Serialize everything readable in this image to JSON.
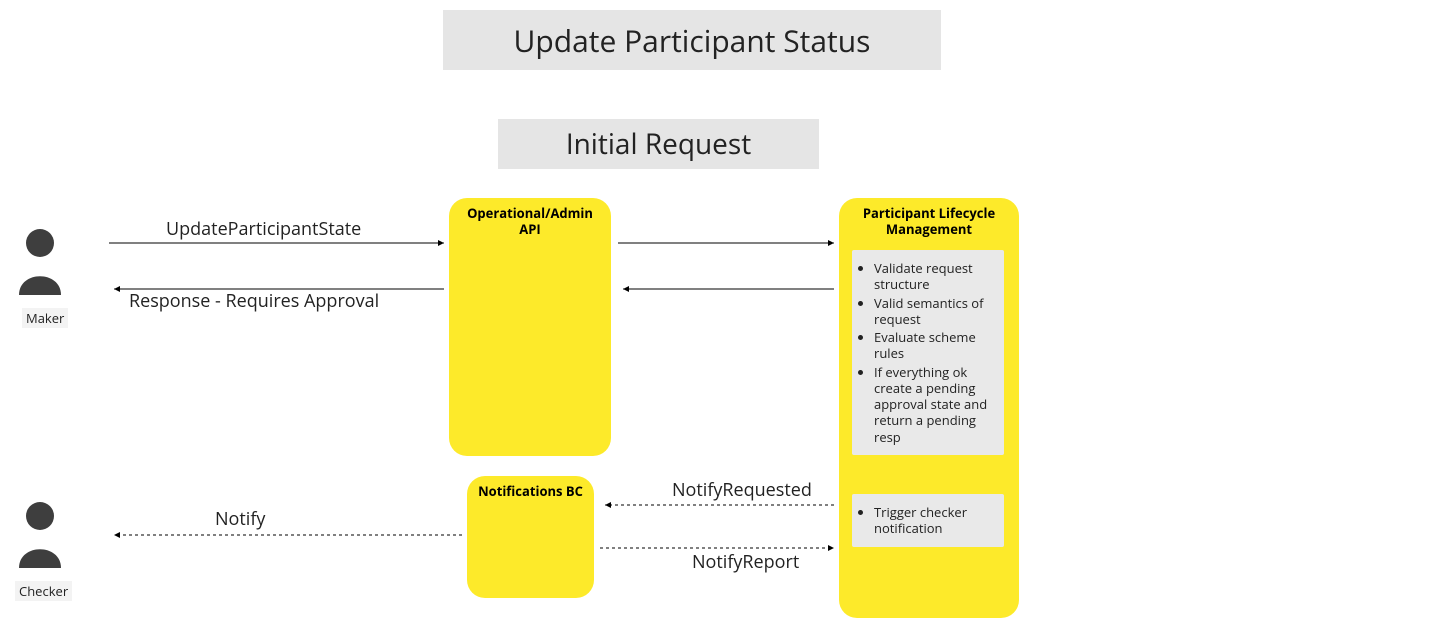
{
  "title": "Update Participant Status",
  "subtitle": "Initial Request",
  "actors": {
    "maker": "Maker",
    "checker": "Checker"
  },
  "components": {
    "api": "Operational/Admin API",
    "notifications": "Notifications BC",
    "participant_lifecycle": "Participant Lifecycle Management"
  },
  "messages": {
    "update_state": "UpdateParticipantState",
    "response_approval": "Response - Requires Approval",
    "notify": "Notify",
    "notify_requested": "NotifyRequested",
    "notify_report": "NotifyReport"
  },
  "lifecycle_steps": [
    "Validate request structure",
    "Valid semantics of request",
    "Evaluate scheme rules",
    "If everything ok create a pending approval state and return a pending resp"
  ],
  "notification_steps": [
    "Trigger checker notification"
  ]
}
